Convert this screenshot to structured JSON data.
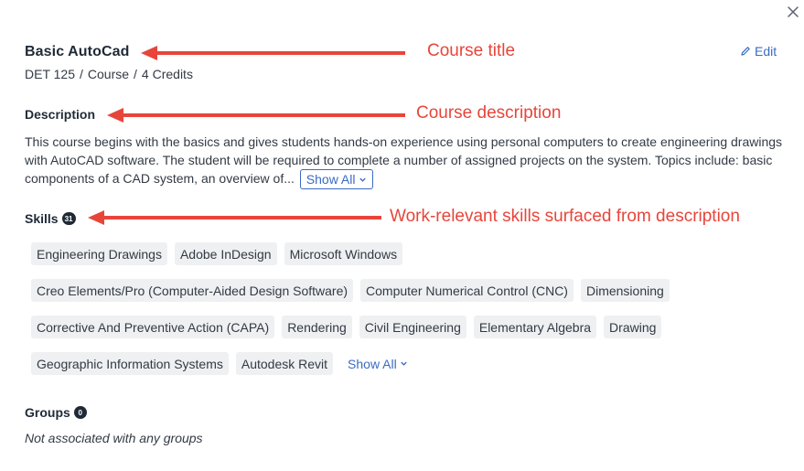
{
  "header": {
    "title": "Basic AutoCad",
    "code": "DET 125",
    "type": "Course",
    "credits": "4 Credits",
    "sep": "/",
    "edit_label": "Edit"
  },
  "description": {
    "heading": "Description",
    "text": "This course begins with the basics and gives students hands-on experience using personal computers to create engineering drawings with AutoCAD software. The student will be required to complete a number of assigned projects on the system. Topics include: basic components of a CAD system, an overview of...",
    "show_all_label": "Show All"
  },
  "skills": {
    "heading": "Skills",
    "count": "31",
    "rows": [
      [
        "Engineering Drawings",
        "Adobe InDesign",
        "Microsoft Windows"
      ],
      [
        "Creo Elements/Pro (Computer-Aided Design Software)",
        "Computer Numerical Control (CNC)",
        "Dimensioning"
      ],
      [
        "Corrective And Preventive Action (CAPA)",
        "Rendering",
        "Civil Engineering",
        "Elementary Algebra",
        "Drawing"
      ],
      [
        "Geographic Information Systems",
        "Autodesk Revit"
      ]
    ],
    "show_all_label": "Show All"
  },
  "groups": {
    "heading": "Groups",
    "count": "0",
    "empty_text": "Not associated with any groups"
  },
  "annotations": {
    "title": "Course title",
    "description": "Course description",
    "skills": "Work-relevant skills surfaced from description"
  },
  "colors": {
    "accent": "#3a6bc4",
    "annotation": "#e8453a",
    "chip_bg": "#eef0f2",
    "heading": "#1f2a37"
  }
}
